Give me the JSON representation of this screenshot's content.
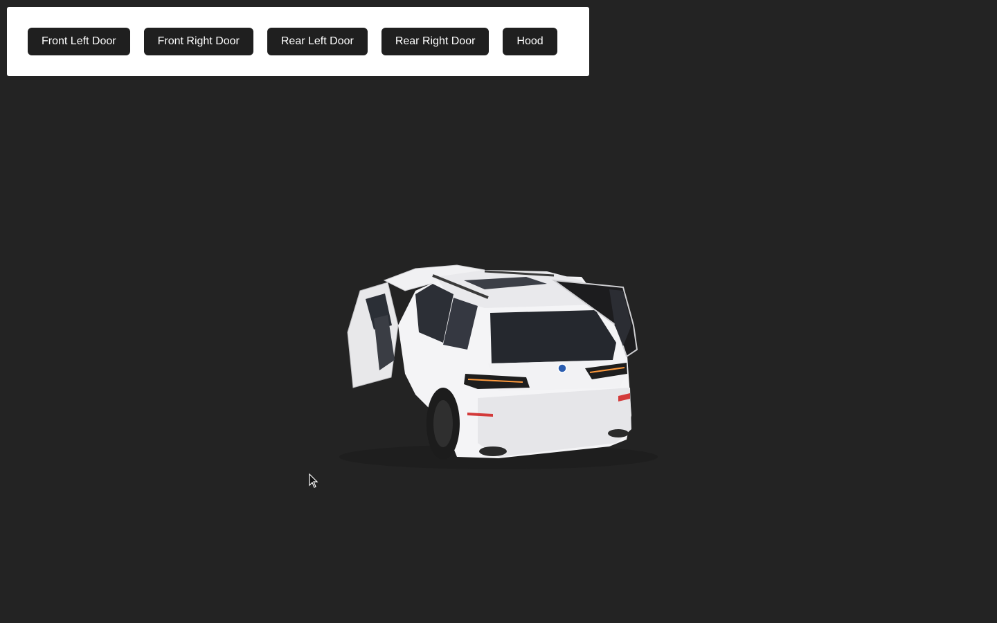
{
  "controls": {
    "buttons": [
      {
        "id": "front-left-door",
        "label": "Front Left Door"
      },
      {
        "id": "front-right-door",
        "label": "Front Right Door"
      },
      {
        "id": "rear-left-door",
        "label": "Rear Left Door"
      },
      {
        "id": "rear-right-door",
        "label": "Rear Right Door"
      },
      {
        "id": "hood",
        "label": "Hood"
      }
    ]
  },
  "scene": {
    "background_color": "#232323",
    "car_color": "#f4f4f6",
    "model": "white SUV, rear three-quarter view, front-left door and rear liftgate open"
  },
  "colors": {
    "panel_bg": "#ffffff",
    "button_bg": "#1f1f1f",
    "button_text": "#ffffff"
  }
}
